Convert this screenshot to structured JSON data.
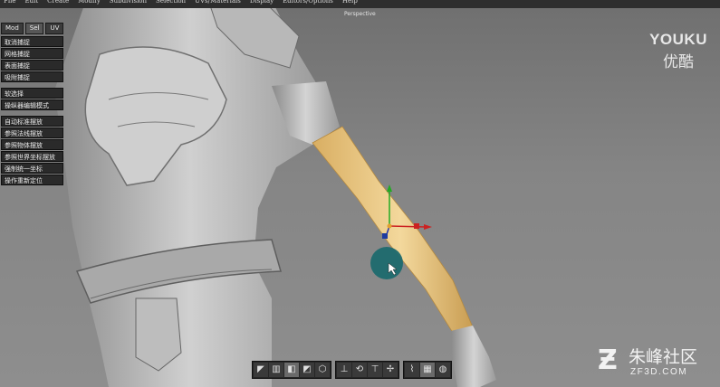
{
  "menubar": {
    "items": [
      "File",
      "Edit",
      "Create",
      "Modify",
      "Subdivision",
      "Selection",
      "UVs/Materials",
      "Display",
      "Editors/Options",
      "Help"
    ]
  },
  "viewport": {
    "label": "Perspective"
  },
  "panel": {
    "tabs": [
      "Mod",
      "Sel",
      "UV"
    ],
    "active_tab": "Sel",
    "group1": [
      "取消捕捉",
      "网格捕捉",
      "表面捕捉",
      "吸附捕捉"
    ],
    "group2": [
      "软选择",
      "操纵器编辑模式"
    ],
    "group3": [
      "自动标准摆放",
      "参照法线摆放",
      "参照物体摆放",
      "参照世界坐标摆放",
      "强制统一坐标",
      "操作重新定位"
    ]
  },
  "watermark": {
    "youku_en": "YOUKU",
    "youku_cn": "优酷",
    "site_cn": "朱峰社区",
    "site_url": "ZF3D.COM"
  },
  "toolbar": {
    "group1_icons": [
      "top-view-icon",
      "front-view-icon",
      "side-view-icon",
      "persp-view-icon",
      "cube-view-icon"
    ],
    "group2_icons": [
      "move-tool-icon",
      "rotate-tool-icon",
      "scale-tool-icon",
      "universal-tool-icon"
    ],
    "group3_icons": [
      "wireframe-icon",
      "smooth-shade-icon",
      "textured-icon"
    ]
  },
  "colors": {
    "menubar": "#2e2e2e",
    "sleeve": "#e8c27a",
    "brush": "#1e6a6e"
  }
}
